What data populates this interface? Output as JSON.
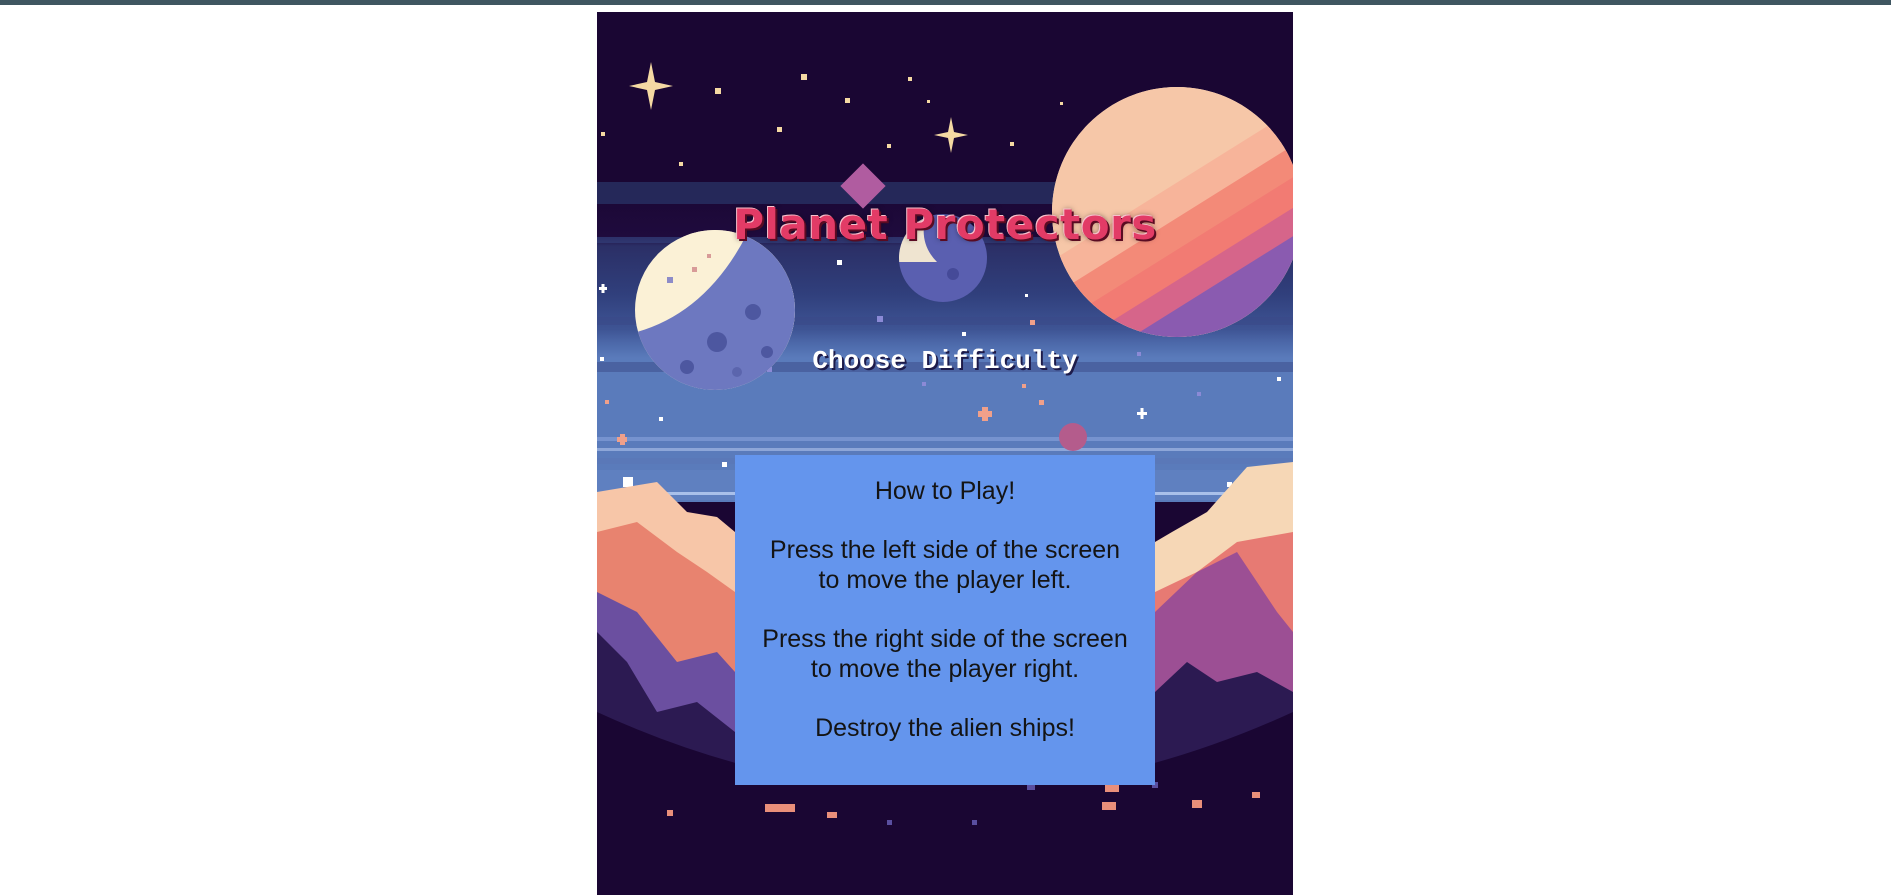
{
  "game": {
    "title": "Planet Protectors",
    "menu_label": "Choose Difficulty",
    "instructions": {
      "heading": "How to Play!",
      "left_line1": "Press the left side of the screen",
      "left_line2": "to move the player left.",
      "right_line1": "Press the right side of the screen",
      "right_line2": "to move the player right.",
      "goal": "Destroy the alien ships!"
    }
  },
  "colors": {
    "page_background": "#ffffff",
    "top_bar": "#3f5661",
    "sky": "#1a0633",
    "title": "#e23b66",
    "instructions_panel": "#6495ed",
    "instructions_text": "#141414"
  }
}
